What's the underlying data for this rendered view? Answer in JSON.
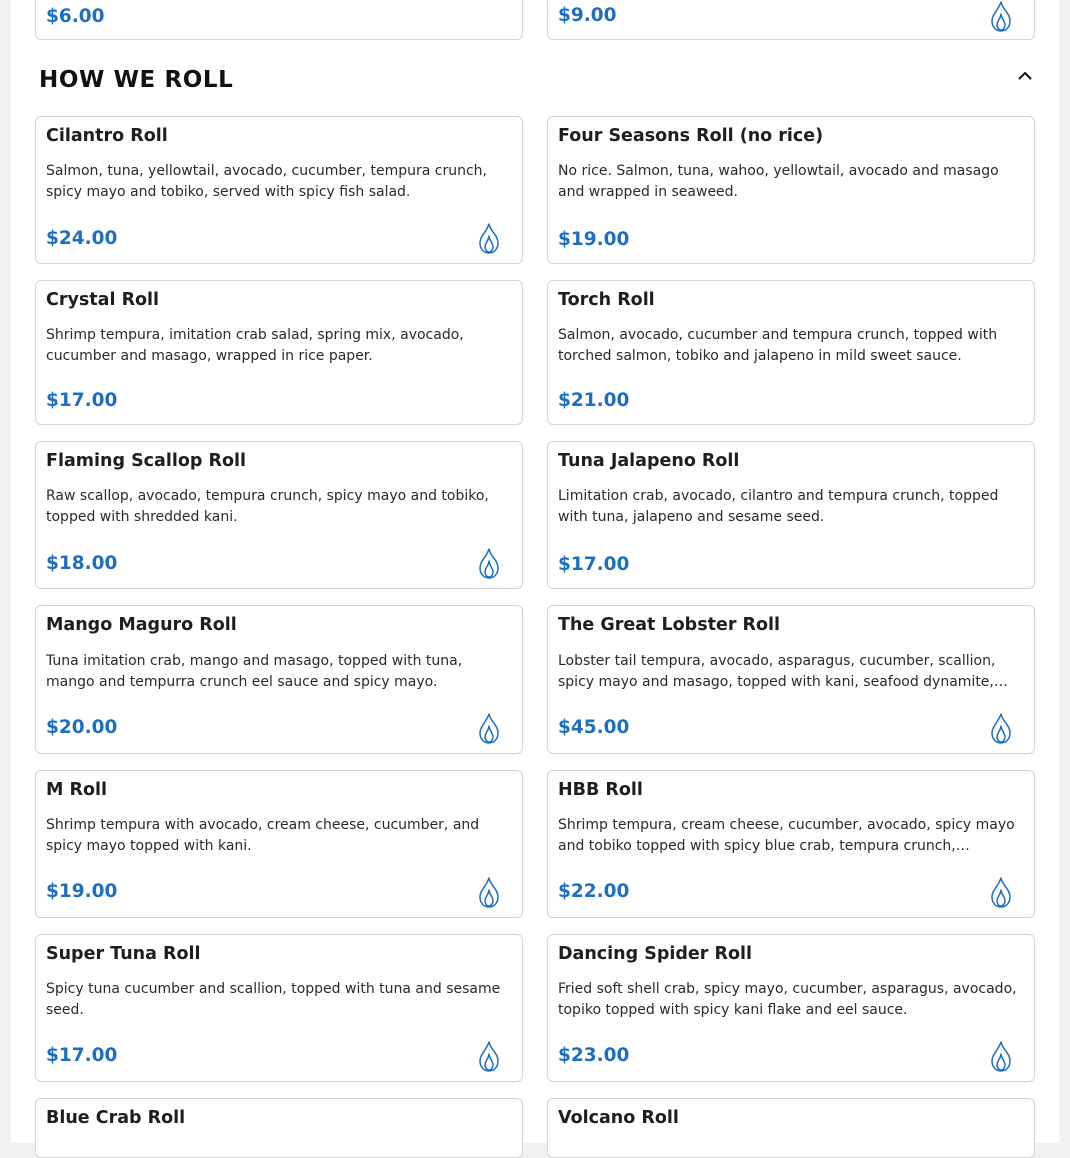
{
  "colors": {
    "price": "#1f6fbf",
    "flame_icon": "#1f6fbf",
    "card_border": "#d4d4d4",
    "text": "#1e1e1e"
  },
  "previous_section": {
    "items": [
      {
        "price": "$6.00",
        "spicy": false
      },
      {
        "price": "$9.00",
        "spicy": true,
        "icon": "flame-icon"
      }
    ]
  },
  "section": {
    "title": "HOW WE ROLL",
    "toggle_icon": "chevron-up-icon",
    "items": [
      {
        "name": "Cilantro Roll",
        "description": "Salmon, tuna, yellowtail, avocado, cucumber, tempura crunch, spicy mayo and tobiko, served with spicy fish salad.",
        "price": "$24.00",
        "spicy": true
      },
      {
        "name": "Four Seasons Roll (no rice)",
        "description": "No rice. Salmon, tuna, wahoo, yellowtail, avocado and masago and wrapped in seaweed.",
        "price": "$19.00",
        "spicy": false
      },
      {
        "name": "Crystal Roll",
        "description": "Shrimp tempura, imitation crab salad, spring mix, avocado, cucumber and masago, wrapped in rice paper.",
        "price": "$17.00",
        "spicy": false
      },
      {
        "name": "Torch Roll",
        "description": "Salmon, avocado, cucumber and tempura crunch, topped with torched salmon, tobiko and jalapeno in mild sweet sauce.",
        "price": "$21.00",
        "spicy": false
      },
      {
        "name": "Flaming Scallop Roll",
        "description": "Raw scallop, avocado, tempura crunch, spicy mayo and tobiko, topped with shredded kani.",
        "price": "$18.00",
        "spicy": true
      },
      {
        "name": "Tuna Jalapeno Roll",
        "description": "Limitation crab, avocado, cilantro and tempura crunch, topped with tuna, jalapeno and sesame seed.",
        "price": "$17.00",
        "spicy": false
      },
      {
        "name": "Mango Maguro Roll",
        "description": "Tuna imitation crab, mango and masago, topped with tuna, mango and tempurra crunch eel sauce and spicy mayo.",
        "price": "$20.00",
        "spicy": true
      },
      {
        "name": "The Great Lobster Roll",
        "description": "Lobster tail tempura, avocado, asparagus, cucumber, scallion, spicy mayo and masago, topped with kani, seafood dynamite,…",
        "price": "$45.00",
        "spicy": true
      },
      {
        "name": "M Roll",
        "description": "Shrimp tempura with avocado, cream cheese, cucumber, and spicy mayo topped with kani.",
        "price": "$19.00",
        "spicy": true
      },
      {
        "name": "HBB Roll",
        "description": "Shrimp tempura, cream cheese, cucumber, avocado, spicy mayo and tobiko topped with spicy blue crab, tempura crunch, sesam…",
        "price": "$22.00",
        "spicy": true
      },
      {
        "name": "Super Tuna Roll",
        "description": "Spicy tuna cucumber and scallion, topped with tuna and sesame seed.",
        "price": "$17.00",
        "spicy": true
      },
      {
        "name": "Dancing Spider Roll",
        "description": "Fried soft shell crab, spicy mayo, cucumber, asparagus, avocado, topiko topped with spicy kani flake and eel sauce.",
        "price": "$23.00",
        "spicy": true
      },
      {
        "name": "Blue Crab Roll",
        "description": "",
        "price": "",
        "spicy": false
      },
      {
        "name": "Volcano Roll",
        "description": "",
        "price": "",
        "spicy": false
      }
    ]
  }
}
